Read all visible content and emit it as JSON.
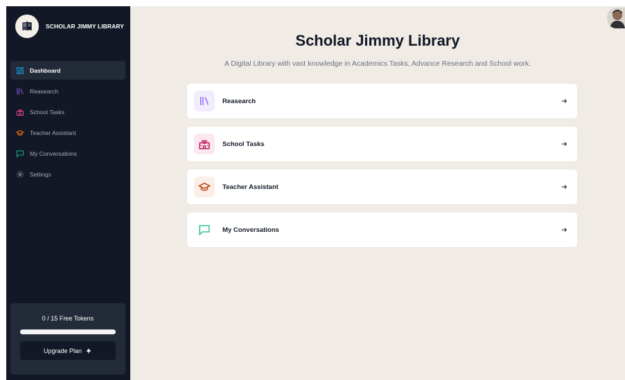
{
  "brand": {
    "name": "SCHOLAR JIMMY LIBRARY",
    "icon": "book-icon"
  },
  "sidebar": {
    "items": [
      {
        "label": "Dashboard",
        "icon": "dashboard-icon",
        "color": "#0ea5e9",
        "active": true
      },
      {
        "label": "Reasearch",
        "icon": "library-icon",
        "color": "#8b5cf6"
      },
      {
        "label": "School Tasks",
        "icon": "school-icon",
        "color": "#ec4899"
      },
      {
        "label": "Teacher Assistant",
        "icon": "graduation-cap-icon",
        "color": "#f97316"
      },
      {
        "label": "My Conversations",
        "icon": "message-square-icon",
        "color": "#10b981"
      },
      {
        "label": "Settings",
        "icon": "settings-icon",
        "color": "#a5acb8"
      }
    ]
  },
  "tokens": {
    "text": "0 / 15 Free Tokens",
    "used": 0,
    "total": 15,
    "upgrade_label": "Upgrade Plan"
  },
  "main": {
    "title": "Scholar Jimmy Library",
    "subtitle": "A Digital Library with vast knowledge in Academics Tasks, Advance Research and School work.",
    "tools": [
      {
        "label": "Reasearch",
        "icon": "library-icon",
        "color": "#8b5cf6",
        "bg": "#f1edfd"
      },
      {
        "label": "School Tasks",
        "icon": "school-icon",
        "color": "#be185d",
        "bg": "#fbe9ef"
      },
      {
        "label": "Teacher Assistant",
        "icon": "graduation-cap-icon",
        "color": "#c2410c",
        "bg": "#fbeee6"
      },
      {
        "label": "My Conversations",
        "icon": "message-square-icon",
        "color": "#10b981",
        "bg": "#ffffff"
      }
    ]
  },
  "colors": {
    "sidebar_bg": "#121826",
    "main_bg": "#f0ebe5",
    "card_bg": "#ffffff"
  }
}
